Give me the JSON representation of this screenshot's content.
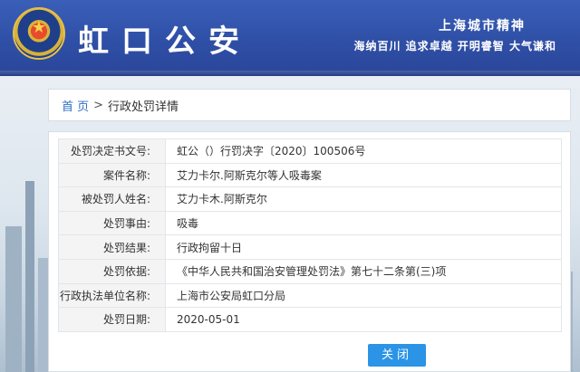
{
  "header": {
    "site_title": "虹口公安",
    "slogan_line1": "上海城市精神",
    "slogan_line2": "海纳百川 追求卓越 开明睿智 大气谦和",
    "emblem_icon": "police-emblem-icon"
  },
  "breadcrumb": {
    "home": "首 页",
    "separator": ">",
    "current": "行政处罚详情"
  },
  "details": {
    "rows": [
      {
        "label": "处罚决定书文号:",
        "value": "虹公（）行罚决字〔2020〕100506号"
      },
      {
        "label": "案件名称:",
        "value": "艾力卡尔.阿斯克尔等人吸毒案"
      },
      {
        "label": "被处罚人姓名:",
        "value": "艾力卡木.阿斯克尔"
      },
      {
        "label": "处罚事由:",
        "value": "吸毒"
      },
      {
        "label": "处罚结果:",
        "value": "行政拘留十日"
      },
      {
        "label": "处罚依据:",
        "value": "《中华人民共和国治安管理处罚法》第七十二条第(三)项"
      },
      {
        "label": "行政执法单位名称:",
        "value": "上海市公安局虹口分局"
      },
      {
        "label": "处罚日期:",
        "value": "2020-05-01"
      }
    ]
  },
  "actions": {
    "close_label": "关闭"
  },
  "colors": {
    "header_blue": "#2f4fa6",
    "link_blue": "#2f6fc4",
    "button_blue": "#2b94e6"
  }
}
